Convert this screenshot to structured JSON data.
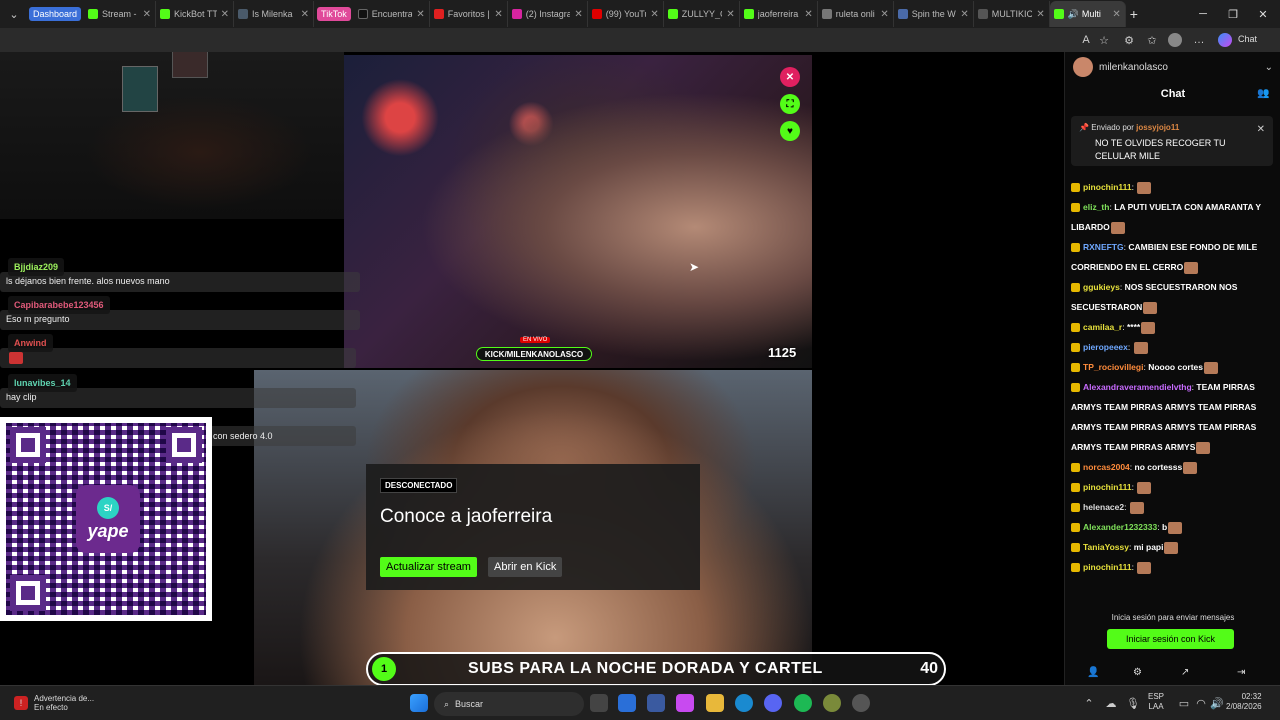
{
  "browser": {
    "tab_groups": [
      {
        "label": "Dashboard",
        "color": "#3a6fd8"
      },
      {
        "label": "TikTok",
        "color": "#e04a9a"
      }
    ],
    "tabs": [
      {
        "title": "Stream - K",
        "color": "#53fc18"
      },
      {
        "title": "KickBot TT",
        "color": "#53fc18"
      },
      {
        "title": "Is Milenka",
        "color": "#4a5a6a"
      },
      {
        "title": "Encuentra",
        "color": "#111111",
        "group": 1
      },
      {
        "title": "Favoritos |",
        "color": "#e02020"
      },
      {
        "title": "(2) Instagra",
        "color": "#d6249f"
      },
      {
        "title": "(99) YouTu",
        "color": "#e00000"
      },
      {
        "title": "ZULLYY_C",
        "color": "#53fc18"
      },
      {
        "title": "jaoferreira",
        "color": "#53fc18"
      },
      {
        "title": "ruleta onli",
        "color": "#777777"
      },
      {
        "title": "Spin the W",
        "color": "#4a6aa8"
      },
      {
        "title": "MULTIKICK",
        "color": "#555555"
      },
      {
        "title": "Multi",
        "color": "#53fc18",
        "active": true
      }
    ],
    "new_tab": "+",
    "chat_label": "Chat"
  },
  "overlay_chat": [
    {
      "user": "Bjjdiaz209",
      "color": "#9cf05c",
      "msg": "ls déjanos bien frente. alos nuevos mano"
    },
    {
      "user": "Capibarabebe123456",
      "color": "#e05a7a",
      "msg": "Eso m pregunto"
    },
    {
      "user": "Anwind",
      "color": "#e05050",
      "msg": ""
    },
    {
      "user": "lunavibes_14",
      "color": "#5fd3b0",
      "msg": "hay clip"
    }
  ],
  "overlay_partial": "con sedero 4.0",
  "qr": {
    "brand": "yape",
    "badge": "S/"
  },
  "video1": {
    "live_label": "EN VIVO",
    "logo_text": "KICK/MILENKANOLASCO",
    "viewers": "1125"
  },
  "offline_card": {
    "badge": "DESCONECTADO",
    "title": "Conoce a jaoferreira",
    "update_btn": "Actualizar stream",
    "open_btn": "Abrir en Kick"
  },
  "subgoal": {
    "num": "1",
    "text": "SUBS PARA LA NOCHE DORADA Y CARTEL",
    "count": "40"
  },
  "chat_panel": {
    "channel": "milenkanolasco",
    "title": "Chat",
    "pinned": {
      "prefix": "Enviado por",
      "by": "jossyjojo11",
      "message": "NO TE OLVIDES RECOGER TU CELULAR MILE"
    },
    "messages": [
      {
        "user": "pinochin111",
        "color": "#e6e03c",
        "text": ""
      },
      {
        "user": "eliz_th",
        "color": "#7fe05a",
        "text": "LA PUTI VUELTA CON AMARANTA Y LIBARDO"
      },
      {
        "user": "RXNEFTG",
        "color": "#6fa8ff",
        "text": "CAMBIEN ESE FONDO DE MILE CORRIENDO EN EL CERRO"
      },
      {
        "user": "ggukieys",
        "color": "#e6e03c",
        "text": "NOS SECUESTRARON NOS SECUESTRARON"
      },
      {
        "user": "camilaa_r",
        "color": "#e6e03c",
        "text": "****"
      },
      {
        "user": "pieropeeex",
        "color": "#6fa8ff",
        "text": ""
      },
      {
        "user": "TP_rociovillegi",
        "color": "#ff8c3c",
        "text": "Noooo cortes"
      },
      {
        "user": "Alexandraveramendielvthg",
        "color": "#c86bff",
        "text": "TEAM PIRRAS ARMYS TEAM PIRRAS ARMYS TEAM PIRRAS ARMYS TEAM PIRRAS ARMYS TEAM PIRRAS ARMYS TEAM PIRRAS ARMYS"
      },
      {
        "user": "norcas2004",
        "color": "#ff8c3c",
        "text": "no cortesss"
      },
      {
        "user": "pinochin111",
        "color": "#e6e03c",
        "text": ""
      },
      {
        "user": "helenace2",
        "color": "#dddddd",
        "text": ""
      },
      {
        "user": "Alexander1232333",
        "color": "#7fe05a",
        "text": "b"
      },
      {
        "user": "TaniaYossy",
        "color": "#e6e03c",
        "text": "mi papi"
      },
      {
        "user": "pinochin111",
        "color": "#e6e03c",
        "text": ""
      }
    ],
    "login_hint": "Inicia sesión para enviar mensajes",
    "login_btn": "Iniciar sesión con Kick"
  },
  "taskbar": {
    "warning_title": "Advertencia de...",
    "warning_sub": "En efecto",
    "search_placeholder": "Buscar",
    "lang": "ESP",
    "lang_sub": "LAA",
    "time": "02:32",
    "date": "2/08/2026"
  }
}
